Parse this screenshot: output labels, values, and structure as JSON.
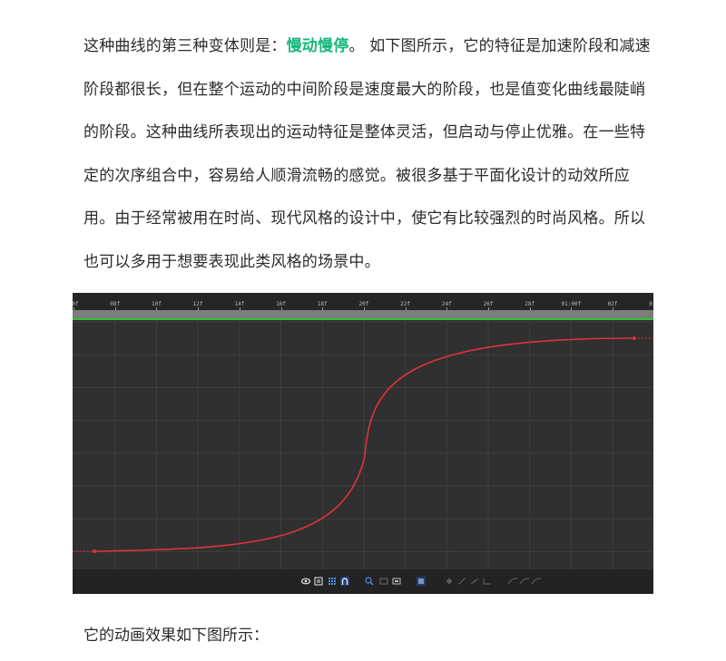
{
  "article": {
    "paragraph_1": {
      "before": "这种曲线的第三种变体则是：",
      "highlight": "慢动慢停",
      "after": "。 如下图所示，它的特征是加速阶段和减速阶段都很长，但在整个运动的中间阶段是速度最大的阶段，也是值变化曲线最陡峭的阶段。这种曲线所表现出的运动特征是整体灵活，但启动与停止优雅。在一些特定的次序组合中，容易给人顺滑流畅的感觉。被很多基于平面化设计的动效所应用。由于经常被用在时尚、现代风格的设计中，使它有比较强烈的时尚风格。所以也可以多用于想要表现此类风格的场景中。"
    },
    "caption": "它的动画效果如下图所示："
  },
  "graph_editor": {
    "ruler_ticks": [
      "0f",
      "08f",
      "10f",
      "12f",
      "14f",
      "16f",
      "18f",
      "20f",
      "22f",
      "24f",
      "26f",
      "28f",
      "01:00f",
      "02f",
      "0"
    ],
    "curve_color": "#e0323a",
    "grid_color": "#3f3f3f",
    "work_area_color": "#7d7d7d",
    "green_bar_color": "#2fc535",
    "toolbar_icons": [
      "eye-icon",
      "list-icon",
      "grid-icon",
      "magnet-icon",
      "zoom-fit-icon",
      "graph-view-icon",
      "frame-icon",
      "snap-icon",
      "keyframe-icon",
      "easy-ease-icon",
      "ease-in-icon",
      "ease-out-icon",
      "separate-dimensions-icon"
    ]
  }
}
